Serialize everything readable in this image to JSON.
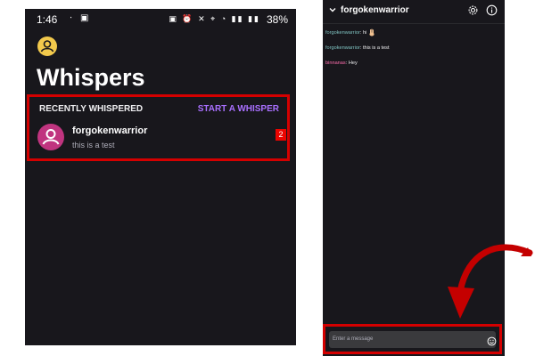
{
  "left_screen": {
    "status": {
      "time": "1:46",
      "battery": "38%"
    },
    "title": "Whispers",
    "section_header": "RECENTLY WHISPERED",
    "start_whisper": "START A WHISPER",
    "conversation": {
      "name": "forgokenwarrior",
      "preview": "this is a test",
      "unread": "2"
    }
  },
  "right_screen": {
    "header": {
      "title": "forgokenwarrior"
    },
    "messages": [
      {
        "user": "forgokenwarrior",
        "sep": ":",
        "text": "hi",
        "color": "#7fc2c0"
      },
      {
        "user": "forgokenwarrior",
        "sep": ":",
        "text": "this is a test",
        "color": "#7fc2c0"
      },
      {
        "user": "binnanas",
        "sep": ":",
        "text": "Hey",
        "color": "#ff6fae"
      }
    ],
    "input": {
      "placeholder": "Enter a message"
    }
  },
  "colors": {
    "accent": "#a970ff",
    "highlight": "#d40000",
    "badge": "#eb0400",
    "background": "#18171c"
  },
  "icons": [
    "user-icon",
    "chevron-down-icon",
    "gear-icon",
    "info-icon",
    "emoji-icon",
    "hand-emoji",
    "arrow-annotation"
  ]
}
